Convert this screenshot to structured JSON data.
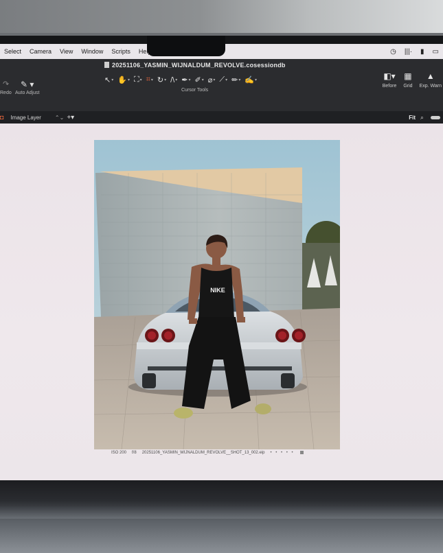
{
  "menubar": {
    "items": [
      "Select",
      "Camera",
      "View",
      "Window",
      "Scripts",
      "Help"
    ]
  },
  "document": {
    "title": "20251106_YASMIN_WIJNALDUM_REVOLVE.cosessiondb"
  },
  "toolbar": {
    "redo_label": "Redo",
    "auto_adjust_label": "Auto Adjust",
    "tools_label": "Cursor Tools",
    "before_label": "Before",
    "grid_label": "Grid",
    "exposure_warning_label": "Exp. Warn"
  },
  "subbar": {
    "layer_label": "Image Layer",
    "zoom_label": "Fit"
  },
  "viewer": {
    "iso": "ISO 200",
    "aperture": "f/8",
    "filename": "20251106_YASMIN_WIJNALDUM_REVOLVE__SHOT_13_002.eip",
    "dots": "• • • • •"
  },
  "photo": {
    "tank_logo_text": "NIKE"
  },
  "colors": {
    "accent_orange": "#e3643b",
    "toolbar_bg": "#2b2c2f",
    "viewer_bg": "#ede6ea",
    "car_silver": "#c9cdd1",
    "sky": "#a9c6d4"
  },
  "icons": {
    "status": [
      "clock-icon",
      "audio-icon",
      "battery-card-icon",
      "battery-icon"
    ],
    "tools": [
      "select-arrow-icon",
      "pan-hand-icon",
      "loupe-icon",
      "crop-icon",
      "rotate-icon",
      "keystone-icon",
      "picker-icon",
      "brush-icon",
      "eraser-icon",
      "gradient-icon",
      "eyedropper-icon",
      "annotate-icon"
    ]
  }
}
